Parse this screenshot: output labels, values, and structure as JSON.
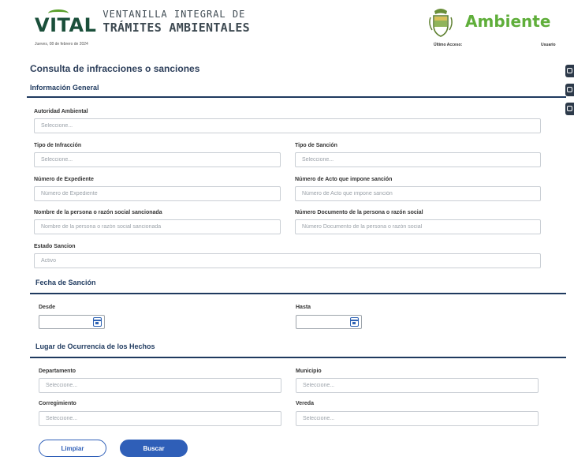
{
  "header": {
    "vital_word": "VITAL",
    "vital_line1": "VENTANILLA INTEGRAL DE",
    "vital_line2": "TRÁMITES AMBIENTALES",
    "date": "Jueves, 08 de febrero de 2024",
    "ministry": "Ambiente",
    "last_access": "Último Acceso:",
    "user": "Usuario"
  },
  "page": {
    "title": "Consulta de infracciones o sanciones"
  },
  "sections": {
    "general": "Información General",
    "fecha": "Fecha de Sanción",
    "lugar": "Lugar de Ocurrencia de los Hechos"
  },
  "fields": {
    "autoridad": {
      "label": "Autoridad Ambiental",
      "placeholder": "Seleccione..."
    },
    "tipo_infraccion": {
      "label": "Tipo de Infracción",
      "placeholder": "Seleccione..."
    },
    "tipo_sancion": {
      "label": "Tipo de Sanción",
      "placeholder": "Seleccione..."
    },
    "expediente": {
      "label": "Número de Expediente",
      "placeholder": "Número de Expediente"
    },
    "acto": {
      "label": "Número de Acto que impone sanción",
      "placeholder": "Número de Acto que impone sanción"
    },
    "nombre": {
      "label": "Nombre de la persona o razón social sancionada",
      "placeholder": "Nombre de la persona o razón social sancionada"
    },
    "documento": {
      "label": "Número Documento de la persona o razón social",
      "placeholder": "Número Documento de la persona o razón social"
    },
    "estado": {
      "label": "Estado Sancion",
      "placeholder": "Activo"
    },
    "desde": {
      "label": "Desde"
    },
    "hasta": {
      "label": "Hasta"
    },
    "departamento": {
      "label": "Departamento",
      "placeholder": "Seleccione..."
    },
    "municipio": {
      "label": "Municipio",
      "placeholder": "Seleccione..."
    },
    "corregimiento": {
      "label": "Corregimiento",
      "placeholder": "Seleccione..."
    },
    "vereda": {
      "label": "Vereda",
      "placeholder": "Seleccione..."
    }
  },
  "buttons": {
    "limpiar": "Limpiar",
    "buscar": "Buscar"
  },
  "colors": {
    "primary": "#2f5fb8",
    "heading": "#1f3a5f",
    "brand_green": "#5fae3a",
    "vital_green": "#1a4f3a"
  }
}
